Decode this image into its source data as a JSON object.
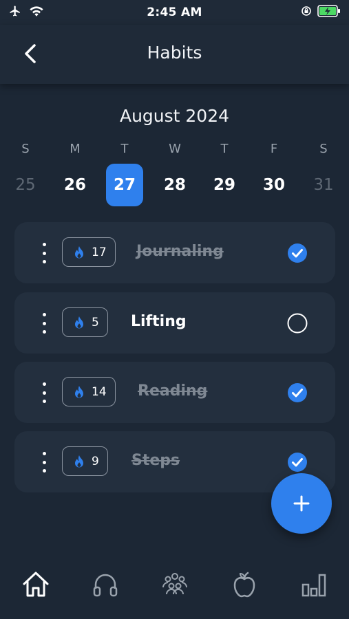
{
  "status_bar": {
    "time": "2:45 AM",
    "icons": [
      "airplane-icon",
      "wifi-icon",
      "orientation-lock-icon",
      "battery-charging-icon"
    ]
  },
  "header": {
    "title": "Habits",
    "back_icon": "chevron-left-icon"
  },
  "calendar": {
    "month": "August 2024",
    "weekdays": [
      "S",
      "M",
      "T",
      "W",
      "T",
      "F",
      "S"
    ],
    "days": [
      "25",
      "26",
      "27",
      "28",
      "29",
      "30",
      "31"
    ],
    "selected_day": "27"
  },
  "habits": [
    {
      "name": "Journaling",
      "streak": "17",
      "completed": true
    },
    {
      "name": "Lifting",
      "streak": "5",
      "completed": false
    },
    {
      "name": "Reading",
      "streak": "14",
      "completed": true
    },
    {
      "name": "Steps",
      "streak": "9",
      "completed": true
    }
  ],
  "fab": {
    "icon": "plus-icon"
  },
  "bottom_nav": {
    "items": [
      "home-icon",
      "headphones-icon",
      "community-icon",
      "apple-icon",
      "stats-icon"
    ],
    "active": "home-icon"
  },
  "colors": {
    "background": "#1c2735",
    "card": "#232f3e",
    "accent": "#2f80ed",
    "muted_text": "#7f8893"
  }
}
